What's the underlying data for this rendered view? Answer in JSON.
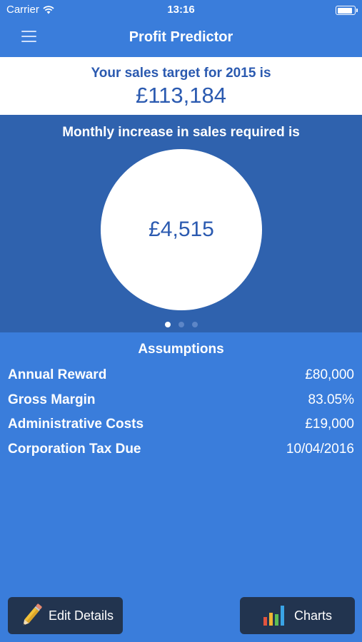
{
  "status": {
    "carrier": "Carrier",
    "time": "13:16",
    "battery_level": 0.9,
    "icons": [
      "wifi-icon",
      "battery-icon"
    ]
  },
  "nav": {
    "title": "Profit Predictor",
    "menu_icon": "hamburger-menu-icon"
  },
  "target": {
    "label": "Your sales target for 2015 is",
    "value": "£113,184"
  },
  "carousel": {
    "heading": "Monthly increase in sales required is",
    "value": "£4,515",
    "page_count": 3,
    "active_page": 1
  },
  "assumptions": {
    "title": "Assumptions",
    "rows": [
      {
        "label": "Annual Reward",
        "value": "£80,000"
      },
      {
        "label": "Gross Margin",
        "value": "83.05%"
      },
      {
        "label": "Administrative Costs",
        "value": "£19,000"
      },
      {
        "label": "Corporation Tax Due",
        "value": "10/04/2016"
      }
    ]
  },
  "buttons": {
    "edit_label": "Edit Details",
    "edit_icon": "pencil-icon",
    "charts_label": "Charts",
    "charts_icon": "bar-chart-icon"
  },
  "colors": {
    "background": "#3a7ddb",
    "carousel": "#2f62ae",
    "accent_text": "#2b5ab0",
    "button": "#22344f"
  }
}
